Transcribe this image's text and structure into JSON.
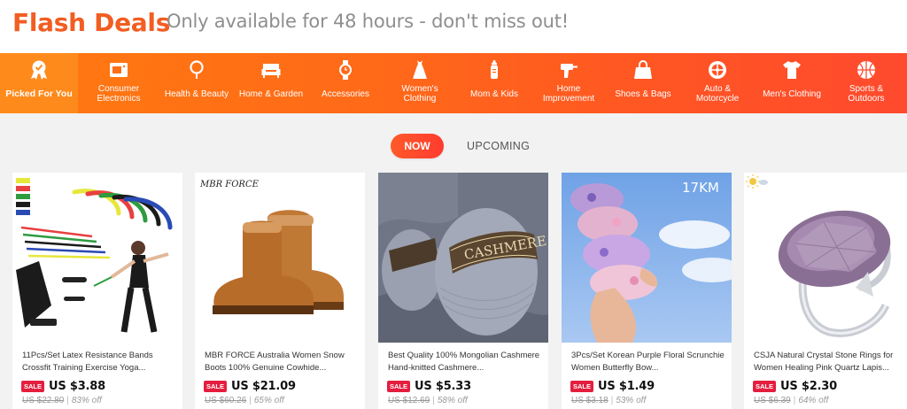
{
  "header": {
    "title": "Flash Deals",
    "subtitle": "Only available for 48 hours - don't miss out!"
  },
  "categories": [
    {
      "label": "Picked For You",
      "icon": "award-badge-icon",
      "active": true
    },
    {
      "label": "Consumer Electronics",
      "icon": "video-camera-icon",
      "active": false
    },
    {
      "label": "Health & Beauty",
      "icon": "mirror-icon",
      "active": false
    },
    {
      "label": "Home & Garden",
      "icon": "sofa-icon",
      "active": false
    },
    {
      "label": "Accessories",
      "icon": "watch-icon",
      "active": false
    },
    {
      "label": "Women's Clothing",
      "icon": "dress-icon",
      "active": false
    },
    {
      "label": "Mom & Kids",
      "icon": "baby-bottle-icon",
      "active": false
    },
    {
      "label": "Home Improvement",
      "icon": "drill-icon",
      "active": false
    },
    {
      "label": "Shoes & Bags",
      "icon": "handbag-icon",
      "active": false
    },
    {
      "label": "Auto & Motorcycle",
      "icon": "wheel-icon",
      "active": false
    },
    {
      "label": "Men's Clothing",
      "icon": "tshirt-icon",
      "active": false
    },
    {
      "label": "Sports & Outdoors",
      "icon": "basketball-icon",
      "active": false
    }
  ],
  "tabs": {
    "now": "NOW",
    "upcoming": "UPCOMING"
  },
  "products": [
    {
      "title": "11Pcs/Set Latex Resistance Bands Crossfit Training Exercise Yoga...",
      "badge": "SALE",
      "price": "US $3.88",
      "original_price": "US $22.80",
      "discount": "83% off"
    },
    {
      "title": "MBR FORCE Australia Women Snow Boots 100% Genuine Cowhide...",
      "badge": "SALE",
      "price": "US $21.09",
      "original_price": "US $60.26",
      "discount": "65% off",
      "brand_mark": "MBR FORCE"
    },
    {
      "title": "Best Quality 100% Mongolian Cashmere Hand-knitted Cashmere...",
      "badge": "SALE",
      "price": "US $5.33",
      "original_price": "US $12.69",
      "discount": "58% off"
    },
    {
      "title": "3Pcs/Set Korean Purple Floral Scrunchie Women Butterfly Bow...",
      "badge": "SALE",
      "price": "US $1.49",
      "original_price": "US $3.18",
      "discount": "53% off",
      "brand_mark": "17KM"
    },
    {
      "title": "CSJA Natural Crystal Stone Rings for Women Healing Pink Quartz Lapis...",
      "badge": "SALE",
      "price": "US $2.30",
      "original_price": "US $6.39",
      "discount": "64% off"
    }
  ],
  "colors": {
    "brand_orange": "#f25d22",
    "sale_red": "#e41e3f",
    "now_tab": "#ff4a2c"
  }
}
